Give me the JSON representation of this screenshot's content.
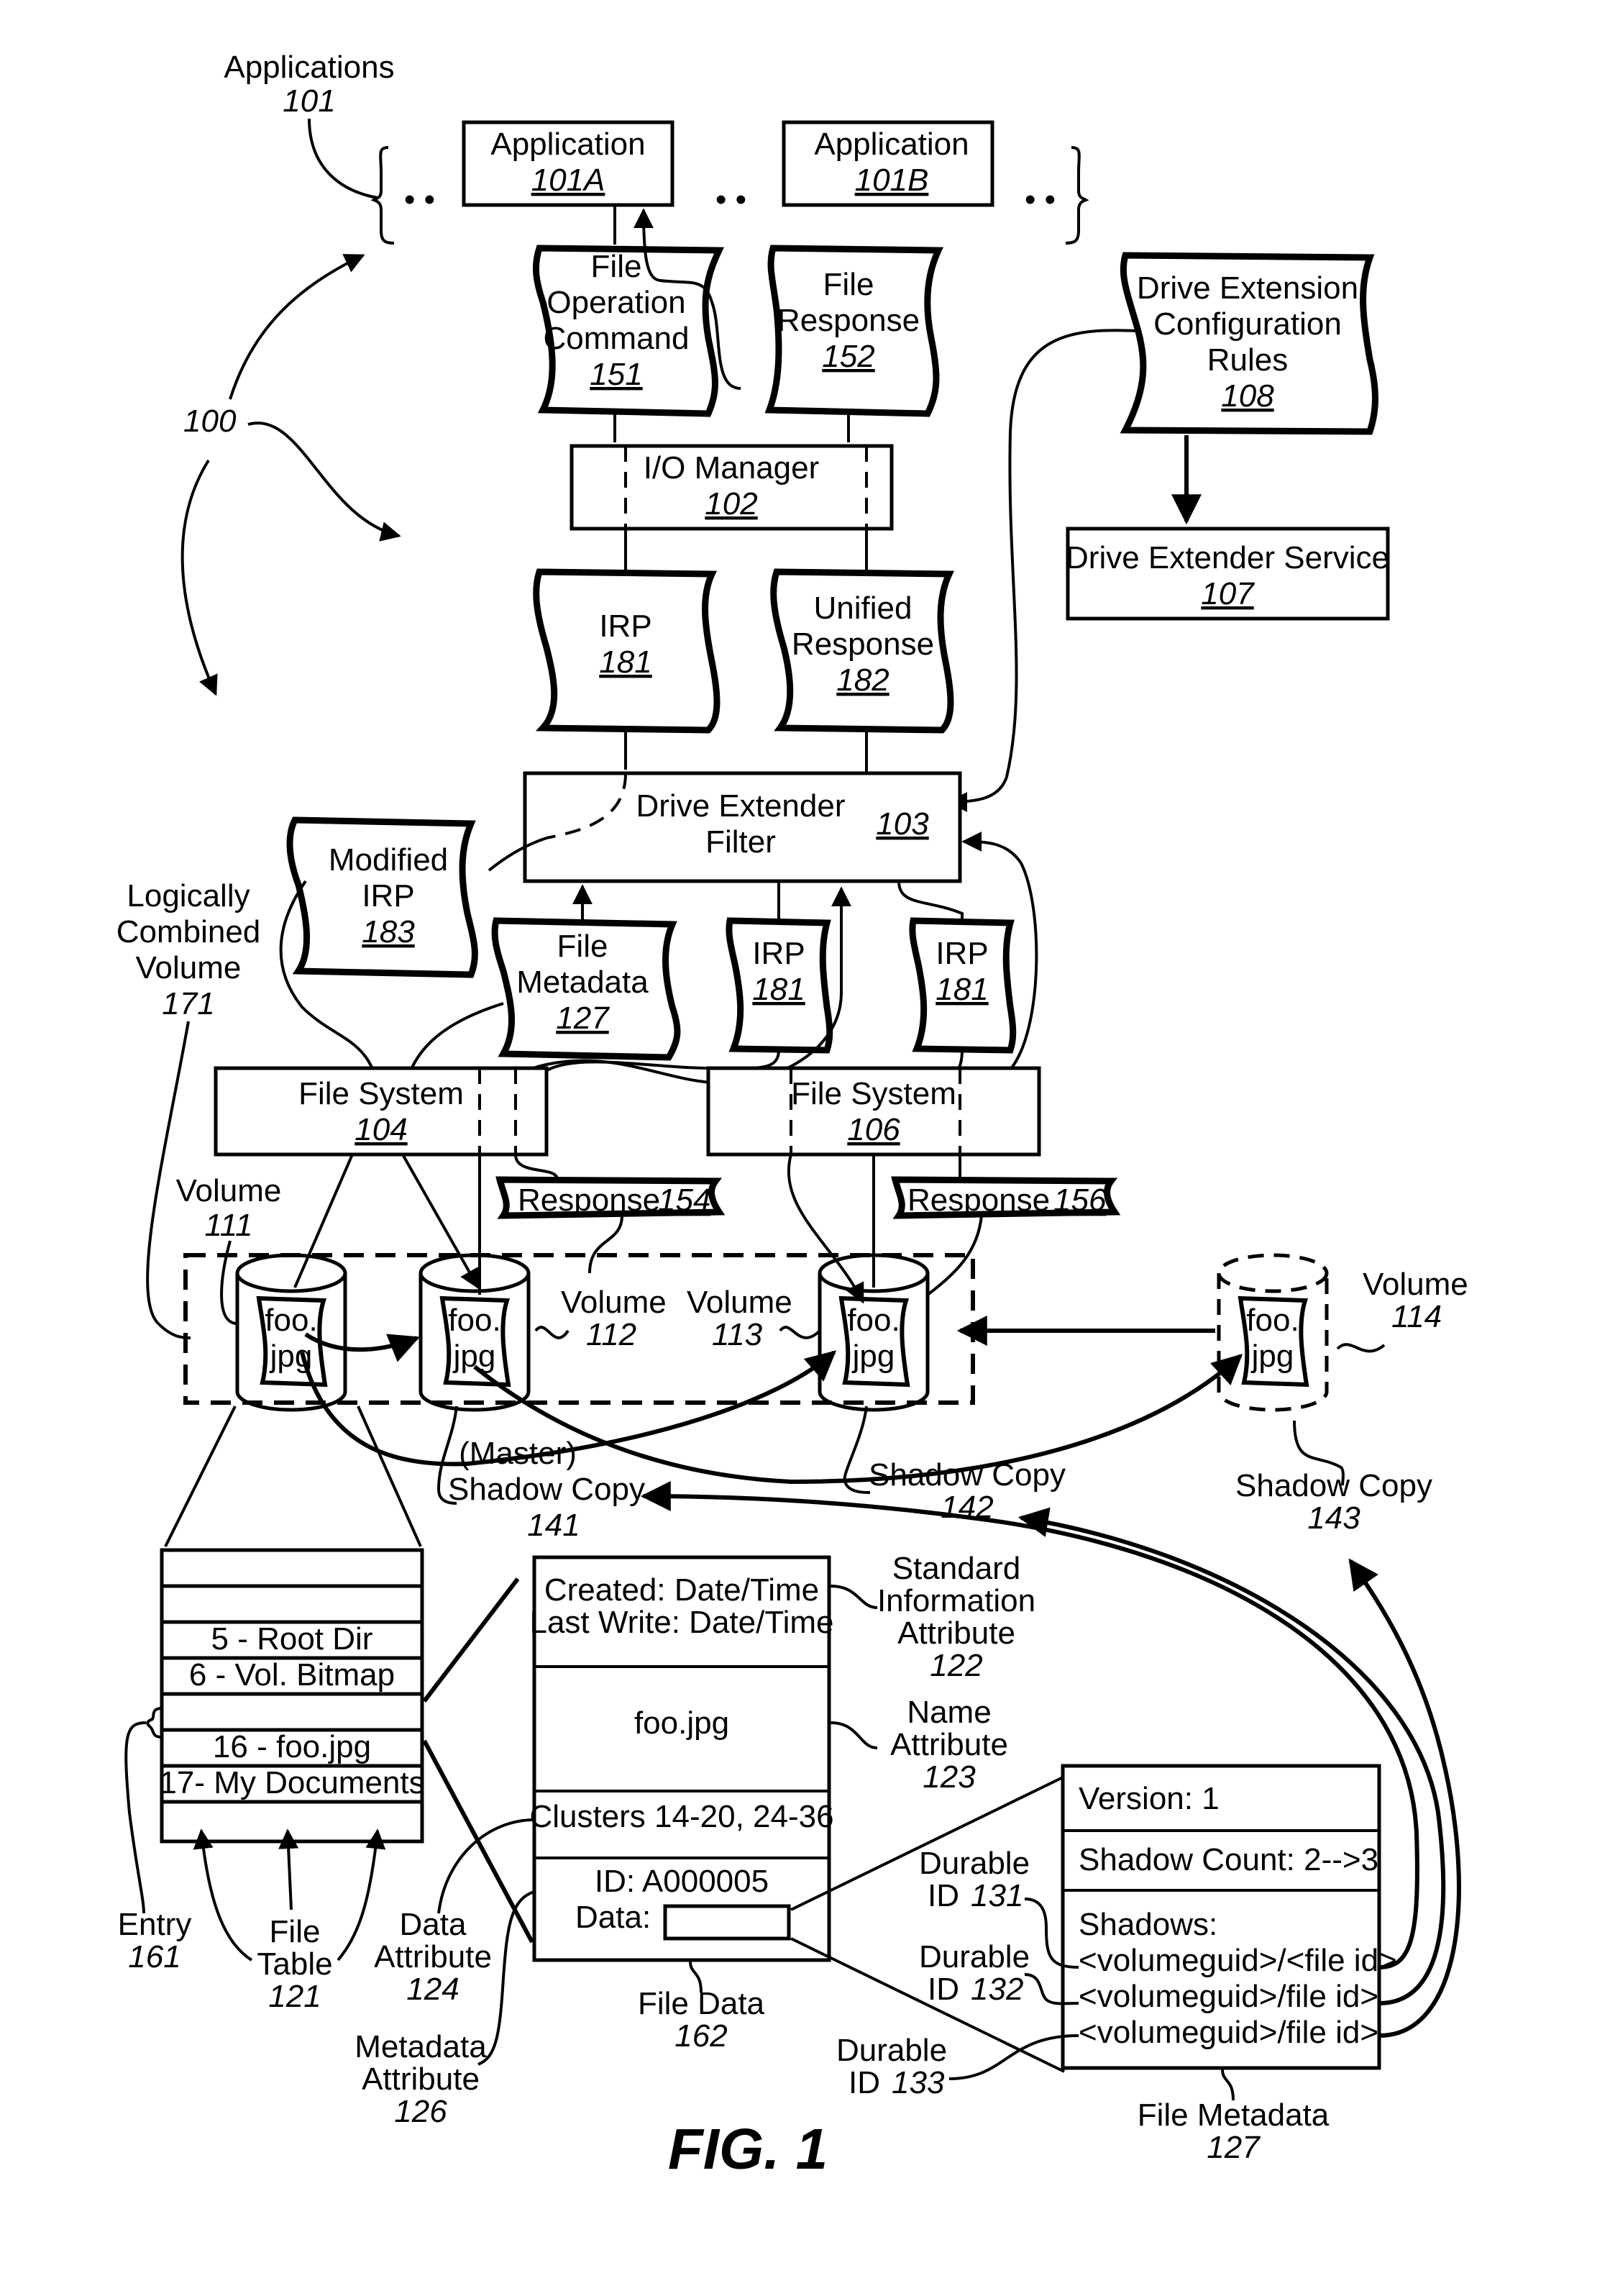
{
  "figure": {
    "caption": "FIG. 1",
    "system_ref": "100"
  },
  "applications": {
    "group_label": "Applications",
    "group_num": "101",
    "ellipsis": "• •",
    "app_a": {
      "label": "Application",
      "num": "101A"
    },
    "app_b": {
      "label": "Application",
      "num": "101B"
    }
  },
  "messages": {
    "file_op_cmd": {
      "lines": [
        "File",
        "Operation",
        "Command"
      ],
      "num": "151"
    },
    "file_response": {
      "lines": [
        "File",
        "Response"
      ],
      "num": "152"
    },
    "irp_top": {
      "label": "IRP",
      "num": "181"
    },
    "unified_response": {
      "lines": [
        "Unified",
        "Response"
      ],
      "num": "182"
    },
    "modified_irp": {
      "lines": [
        "Modified",
        "IRP"
      ],
      "num": "183"
    },
    "file_metadata_msg": {
      "lines": [
        "File",
        "Metadata"
      ],
      "num": "127"
    },
    "irp_mid": {
      "label": "IRP",
      "num": "181"
    },
    "irp_right": {
      "label": "IRP",
      "num": "181"
    },
    "response_154": {
      "label": "Response",
      "num": "154"
    },
    "response_156": {
      "label": "Response",
      "num": "156"
    }
  },
  "components": {
    "io_manager": {
      "label": "I/O Manager",
      "num": "102"
    },
    "de_filter": {
      "lines": [
        "Drive Extender",
        "Filter"
      ],
      "num": "103"
    },
    "config_rules": {
      "lines": [
        "Drive Extension",
        "Configuration",
        "Rules"
      ],
      "num": "108"
    },
    "de_service": {
      "label": "Drive Extender Service",
      "num": "107"
    },
    "fs_104": {
      "label": "File System",
      "num": "104"
    },
    "fs_106": {
      "label": "File System",
      "num": "106"
    }
  },
  "volumes": {
    "logical": {
      "lines": [
        "Logically",
        "Combined",
        "Volume"
      ],
      "num": "171"
    },
    "v111": {
      "label": "Volume",
      "num": "111"
    },
    "v112": {
      "label": "Volume",
      "num": "112"
    },
    "v113": {
      "label": "Volume",
      "num": "113"
    },
    "v114": {
      "label": "Volume",
      "num": "114"
    },
    "file_line1": "foo.",
    "file_line2": "jpg"
  },
  "shadows": {
    "s141": {
      "lines": [
        "(Master)",
        "Shadow Copy"
      ],
      "num": "141"
    },
    "s142": {
      "label": "Shadow Copy",
      "num": "142"
    },
    "s143": {
      "label": "Shadow Copy",
      "num": "143"
    }
  },
  "file_table": {
    "rows": [
      "",
      "",
      "5 - Root Dir",
      "6 - Vol. Bitmap",
      "",
      "16 - foo.jpg",
      "17- My Documents",
      ""
    ],
    "entry": {
      "label": "Entry",
      "num": "161"
    },
    "table": {
      "lines": [
        "File",
        "Table"
      ],
      "num": "121"
    }
  },
  "record": {
    "created": "Created: Date/Time",
    "last_write": "Last Write: Date/Time",
    "name": "foo.jpg",
    "clusters": "Clusters 14-20, 24-36",
    "id": "ID: A000005",
    "data_label": "Data:",
    "std_info": {
      "lines": [
        "Standard",
        "Information",
        "Attribute"
      ],
      "num": "122"
    },
    "name_attr": {
      "lines": [
        "Name",
        "Attribute"
      ],
      "num": "123"
    },
    "data_attr": {
      "lines": [
        "Data",
        "Attribute"
      ],
      "num": "124"
    },
    "meta_attr": {
      "lines": [
        "Metadata",
        "Attribute"
      ],
      "num": "126"
    },
    "file_data": {
      "label": "File Data",
      "num": "162"
    }
  },
  "metadata": {
    "version": "Version:  1",
    "shadow_count": "Shadow Count:  2-->3",
    "shadows_label": "Shadows:",
    "entries": [
      "<volumeguid>/<file id>",
      "<volumeguid>/file id>",
      "<volumeguid>/file id>"
    ],
    "durable": [
      {
        "label": "Durable",
        "id": "ID",
        "num": "131"
      },
      {
        "label": "Durable",
        "id": "ID",
        "num": "132"
      },
      {
        "label": "Durable",
        "id": "ID",
        "num": "133"
      }
    ],
    "caption": {
      "label": "File Metadata",
      "num": "127"
    }
  }
}
